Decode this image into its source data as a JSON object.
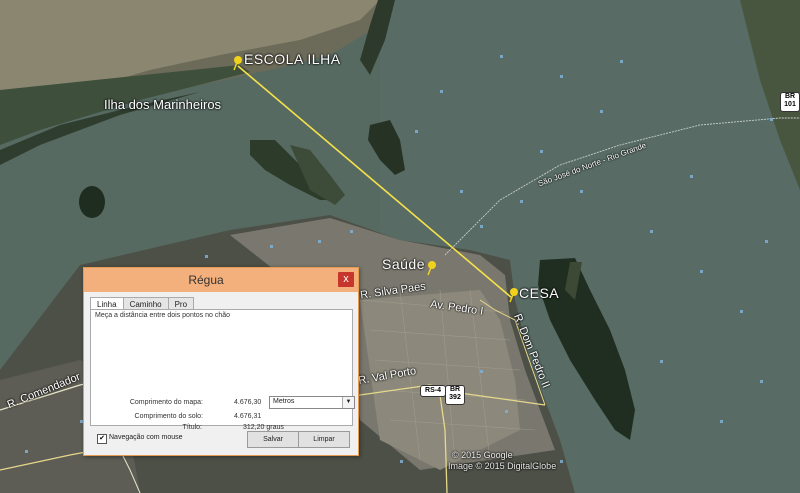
{
  "map": {
    "labels": {
      "escola": "ESCOLA ILHA",
      "marinheiros": "Ilha dos Marinheiros",
      "saude": "Saúde",
      "cesa": "CESA",
      "silva_paes": "R. Silva Paes",
      "av_pedro": "Av. Pedro I",
      "val_porto": "R. Val Porto",
      "comendador": "R. Comendador",
      "avenida_right": "R. Dom Pedro II",
      "route_label": "São José do Norte - Rio Grande"
    },
    "shields": {
      "br101": "BR\n101",
      "br392": "BR\n392",
      "rs4": "RS-4"
    },
    "copyright": "© 2015 Google",
    "image_credit": "Image © 2015 DigitalGlobe",
    "colors": {
      "water": "#4f625c",
      "land": "#3f4a3a",
      "measure_line": "#f5e24a",
      "pin": "#f0d21c"
    },
    "icons": [
      "pushpin-icon",
      "photo-icon"
    ]
  },
  "dialog": {
    "title": "Régua",
    "close": "x",
    "tabs": [
      "Linha",
      "Caminho",
      "Pro"
    ],
    "description": "Meça a distância entre dois pontos no chão",
    "map_length_label": "Comprimento do mapa:",
    "map_length_value": "4.676,30",
    "ground_length_label": "Comprimento do solo:",
    "ground_length_value": "4.676,31",
    "heading_label": "Título:",
    "heading_value": "312,20 graus",
    "units": "Metros",
    "mouse_nav": "Navegação com mouse",
    "mouse_nav_checked": "✔",
    "save": "Salvar",
    "clear": "Limpar"
  }
}
